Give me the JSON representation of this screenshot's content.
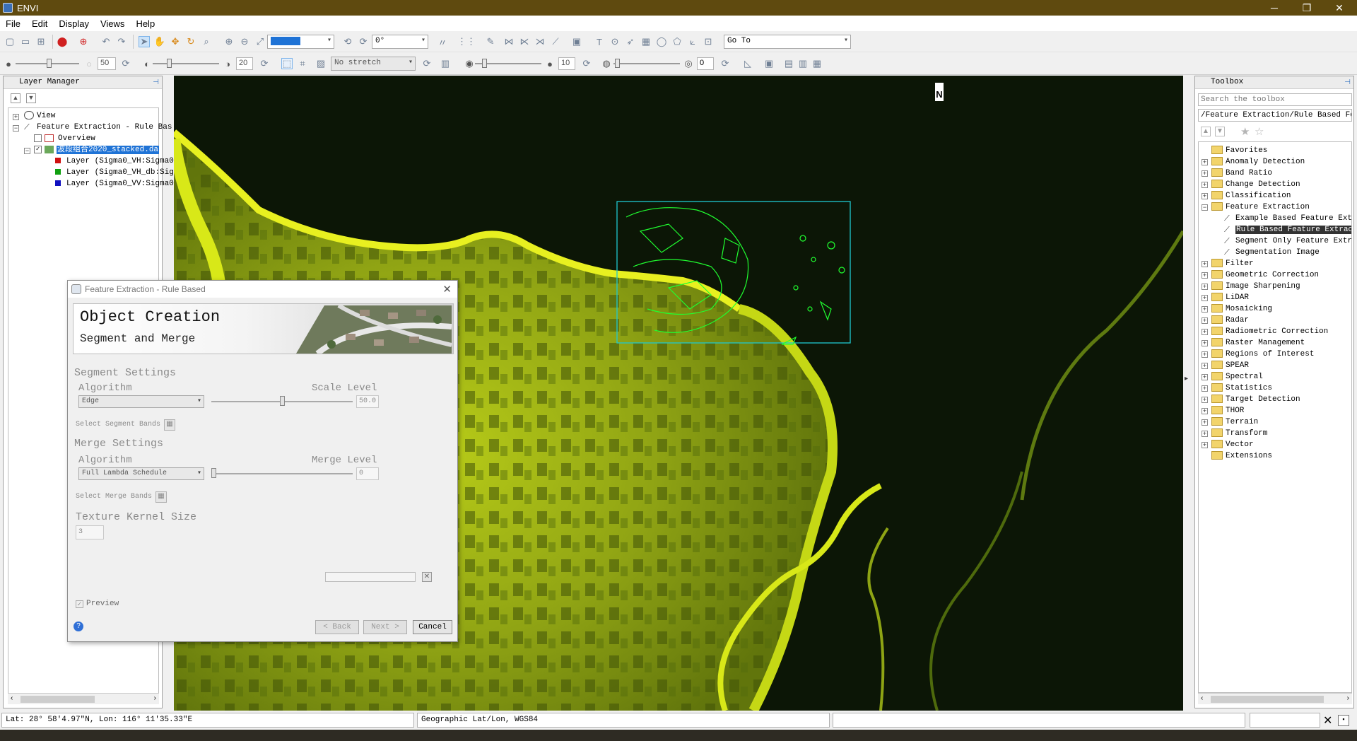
{
  "app": {
    "title": "ENVI"
  },
  "window_controls": {
    "minimize": "─",
    "maximize": "❐",
    "close": "✕"
  },
  "menu": [
    "File",
    "Edit",
    "Display",
    "Views",
    "Help"
  ],
  "toolbar": {
    "rotation_value": "0°",
    "goto_value": "Go To",
    "brightness_value": "50",
    "contrast_value": "20",
    "stretch_value": "No stretch",
    "sharpen_value": "10",
    "transparency_value": "0"
  },
  "layer_manager": {
    "title": "Layer Manager",
    "items": [
      {
        "label": "View"
      },
      {
        "label": "Feature Extraction - Rule Bas"
      },
      {
        "label": "Overview"
      },
      {
        "label": "波段组合2020_stacked.da"
      },
      {
        "label": "Layer (Sigma0_VH:Sigma0",
        "color": "#d01010"
      },
      {
        "label": "Layer (Sigma0_VH_db:Sig",
        "color": "#10a010"
      },
      {
        "label": "Layer (Sigma0_VV:Sigma0",
        "color": "#1010c0"
      }
    ]
  },
  "toolbox": {
    "title": "Toolbox",
    "search_placeholder": "Search the toolbox",
    "path": "/Feature Extraction/Rule Based Featu",
    "items": [
      {
        "label": "Favorites",
        "type": "folder",
        "level": 0,
        "expandable": false
      },
      {
        "label": "Anomaly Detection",
        "type": "folder",
        "level": 0,
        "expandable": true
      },
      {
        "label": "Band Ratio",
        "type": "folder",
        "level": 0,
        "expandable": true
      },
      {
        "label": "Change Detection",
        "type": "folder",
        "level": 0,
        "expandable": true
      },
      {
        "label": "Classification",
        "type": "folder",
        "level": 0,
        "expandable": true
      },
      {
        "label": "Feature Extraction",
        "type": "folder",
        "level": 0,
        "expandable": true,
        "expanded": true
      },
      {
        "label": "Example Based Feature Extr",
        "type": "tool",
        "level": 1
      },
      {
        "label": "Rule Based Feature Extract",
        "type": "tool",
        "level": 1,
        "selected": true
      },
      {
        "label": "Segment Only Feature Extra",
        "type": "tool",
        "level": 1
      },
      {
        "label": "Segmentation Image",
        "type": "tool",
        "level": 1
      },
      {
        "label": "Filter",
        "type": "folder",
        "level": 0,
        "expandable": true
      },
      {
        "label": "Geometric Correction",
        "type": "folder",
        "level": 0,
        "expandable": true
      },
      {
        "label": "Image Sharpening",
        "type": "folder",
        "level": 0,
        "expandable": true
      },
      {
        "label": "LiDAR",
        "type": "folder",
        "level": 0,
        "expandable": true
      },
      {
        "label": "Mosaicking",
        "type": "folder",
        "level": 0,
        "expandable": true
      },
      {
        "label": "Radar",
        "type": "folder",
        "level": 0,
        "expandable": true
      },
      {
        "label": "Radiometric Correction",
        "type": "folder",
        "level": 0,
        "expandable": true
      },
      {
        "label": "Raster Management",
        "type": "folder",
        "level": 0,
        "expandable": true
      },
      {
        "label": "Regions of Interest",
        "type": "folder",
        "level": 0,
        "expandable": true
      },
      {
        "label": "SPEAR",
        "type": "folder",
        "level": 0,
        "expandable": true
      },
      {
        "label": "Spectral",
        "type": "folder",
        "level": 0,
        "expandable": true
      },
      {
        "label": "Statistics",
        "type": "folder",
        "level": 0,
        "expandable": true
      },
      {
        "label": "Target Detection",
        "type": "folder",
        "level": 0,
        "expandable": true
      },
      {
        "label": "THOR",
        "type": "folder",
        "level": 0,
        "expandable": true
      },
      {
        "label": "Terrain",
        "type": "folder",
        "level": 0,
        "expandable": true
      },
      {
        "label": "Transform",
        "type": "folder",
        "level": 0,
        "expandable": true
      },
      {
        "label": "Vector",
        "type": "folder",
        "level": 0,
        "expandable": true
      },
      {
        "label": "Extensions",
        "type": "folder",
        "level": 0,
        "expandable": false
      }
    ]
  },
  "viewer": {
    "north_arrow": "N"
  },
  "dialog": {
    "title": "Feature Extraction - Rule Based",
    "banner_title": "Object Creation",
    "banner_subtitle": "Segment and Merge",
    "segment_settings": "Segment Settings",
    "algorithm_label": "Algorithm",
    "scale_level_label": "Scale Level",
    "segment_algorithm": "Edge",
    "scale_level_value": "50.0",
    "scale_level": 0.5,
    "select_segment_bands": "Select Segment Bands",
    "merge_settings": "Merge Settings",
    "merge_algorithm_label": "Algorithm",
    "merge_level_label": "Merge Level",
    "merge_algorithm": "Full Lambda Schedule",
    "merge_level_value": "0",
    "merge_level": 0,
    "select_merge_bands": "Select Merge Bands",
    "texture_kernel_label": "Texture Kernel Size",
    "texture_kernel_value": "3",
    "preview_label": "Preview",
    "back_label": "< Back",
    "next_label": "Next >",
    "cancel_label": "Cancel",
    "help": "?"
  },
  "status": {
    "coords": "Lat: 28° 58'4.97\"N, Lon: 116° 11'35.33\"E",
    "projection": "Geographic Lat/Lon, WGS84"
  }
}
